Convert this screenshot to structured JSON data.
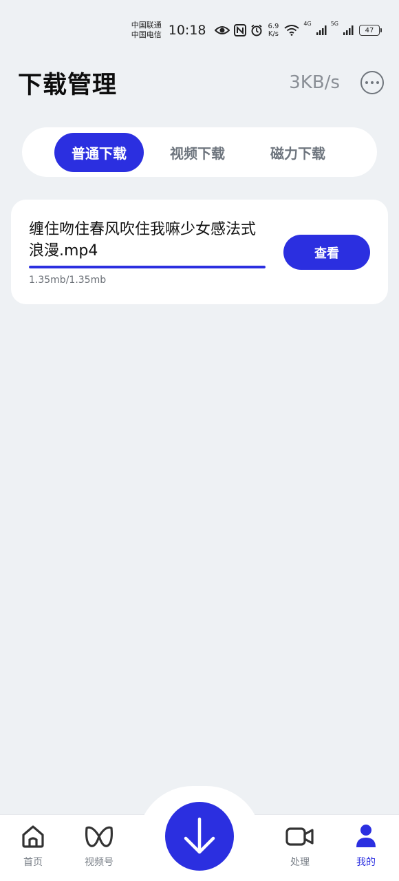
{
  "status_bar": {
    "carrier1": "中国联通",
    "carrier2": "中国电信",
    "time": "10:18",
    "net_speed_value": "6.9",
    "net_speed_unit": "K/s",
    "signal1_label": "4G",
    "signal2_label": "5G",
    "battery": "47"
  },
  "header": {
    "title": "下载管理",
    "speed": "3KB/s"
  },
  "tabs": [
    {
      "label": "普通下载",
      "active": true
    },
    {
      "label": "视频下载",
      "active": false
    },
    {
      "label": "磁力下载",
      "active": false
    }
  ],
  "downloads": [
    {
      "file_name": "缠住吻住春风吹住我嘛少女感法式浪漫.mp4",
      "size": "1.35mb/1.35mb",
      "progress": 1.0,
      "action_label": "查看"
    }
  ],
  "bottom_nav": {
    "items": [
      {
        "label": "首页",
        "icon": "home-icon"
      },
      {
        "label": "视频号",
        "icon": "channels-icon"
      },
      {
        "label": "处理",
        "icon": "video-camera-icon"
      },
      {
        "label": "我的",
        "icon": "user-icon",
        "active": true
      }
    ],
    "fab_icon": "download-arrow-icon"
  },
  "colors": {
    "accent": "#2b2fe0",
    "background": "#eef1f4"
  }
}
